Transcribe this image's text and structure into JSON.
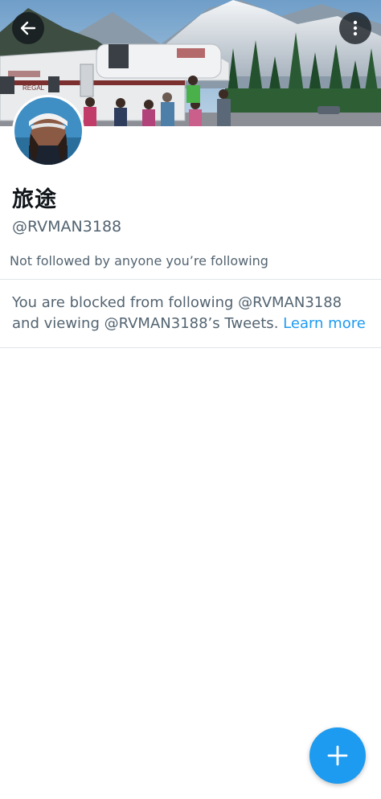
{
  "profile": {
    "display_name": "旅途",
    "handle": "@RVMAN3188",
    "followers_note": "Not followed by anyone you’re following"
  },
  "blocked_notice": {
    "text": "You are blocked from following @RVMAN3188 and viewing @RVMAN3188’s Tweets.",
    "link_label": "Learn more"
  },
  "banner": {
    "rv_brand_label": "REGAL"
  },
  "icons": {
    "back": "arrow-left-icon",
    "more": "more-vertical-icon",
    "compose": "plus-icon"
  },
  "colors": {
    "accent": "#1d9bf0",
    "text_primary": "#0f1419",
    "text_secondary": "#536471"
  }
}
